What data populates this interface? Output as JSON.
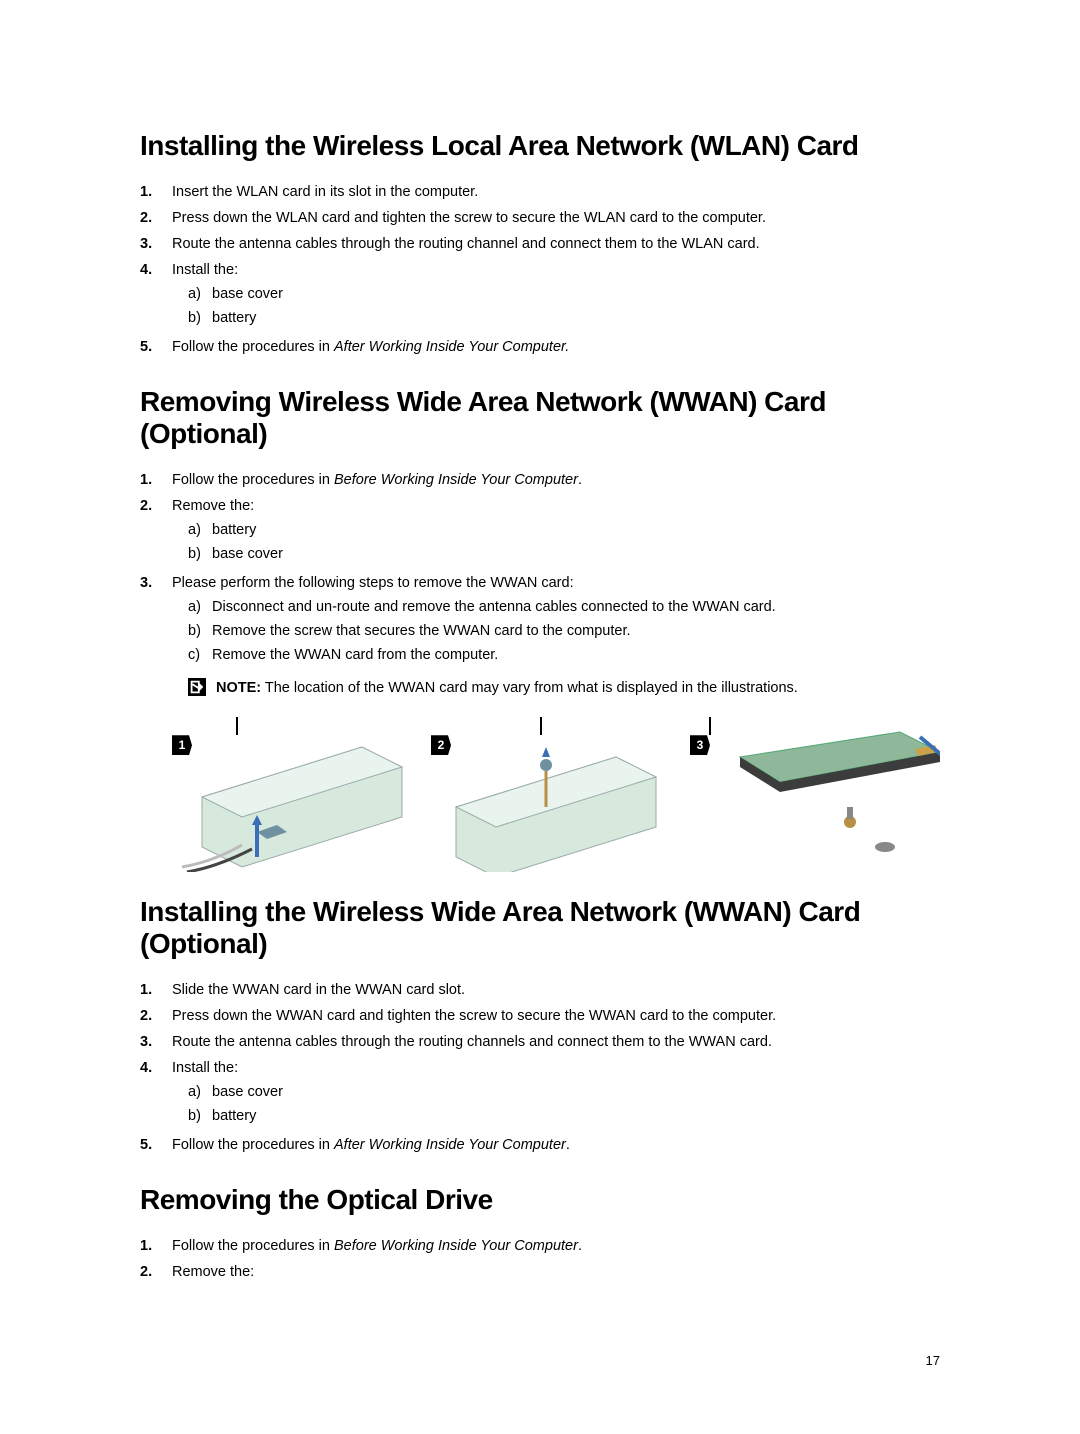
{
  "pageNumber": "17",
  "sections": [
    {
      "heading": "Installing the Wireless Local Area Network (WLAN) Card",
      "steps": [
        {
          "num": "1.",
          "text": "Insert the WLAN card in its slot in the computer."
        },
        {
          "num": "2.",
          "text": "Press down the WLAN card and tighten the screw to secure the WLAN card to the computer."
        },
        {
          "num": "3.",
          "text": "Route the antenna cables through the routing channel and connect them to the WLAN card."
        },
        {
          "num": "4.",
          "text": "Install the:",
          "sub": [
            {
              "mark": "a)",
              "text": "base cover"
            },
            {
              "mark": "b)",
              "text": "battery"
            }
          ]
        },
        {
          "num": "5.",
          "prefix": "Follow the procedures in ",
          "italic": "After Working Inside Your Computer.",
          "suffix": ""
        }
      ]
    },
    {
      "heading": "Removing Wireless Wide Area Network (WWAN) Card (Optional)",
      "steps": [
        {
          "num": "1.",
          "prefix": "Follow the procedures in ",
          "italic": "Before Working Inside Your Computer",
          "suffix": "."
        },
        {
          "num": "2.",
          "text": "Remove the:",
          "sub": [
            {
              "mark": "a)",
              "text": "battery"
            },
            {
              "mark": "b)",
              "text": "base cover"
            }
          ]
        },
        {
          "num": "3.",
          "text": "Please perform the following steps to remove the WWAN card:",
          "sub": [
            {
              "mark": "a)",
              "text": "Disconnect and un-route and remove the antenna cables connected to the WWAN card."
            },
            {
              "mark": "b)",
              "text": "Remove the screw that secures the WWAN card to the computer."
            },
            {
              "mark": "c)",
              "text": "Remove the WWAN card from the computer."
            }
          ],
          "note": {
            "label": "NOTE:",
            "text": " The location of the WWAN card may vary from what is displayed in the illustrations."
          }
        }
      ],
      "figures": [
        {
          "label": "1"
        },
        {
          "label": "2"
        },
        {
          "label": "3"
        }
      ]
    },
    {
      "heading": "Installing the Wireless Wide Area Network (WWAN) Card (Optional)",
      "steps": [
        {
          "num": "1.",
          "text": "Slide the WWAN card in the WWAN card slot."
        },
        {
          "num": "2.",
          "text": "Press down the WWAN card and tighten the screw to secure the WWAN card to the computer."
        },
        {
          "num": "3.",
          "text": "Route the antenna cables through the routing channels and connect them to the WWAN card."
        },
        {
          "num": "4.",
          "text": "Install the:",
          "sub": [
            {
              "mark": "a)",
              "text": "base cover"
            },
            {
              "mark": "b)",
              "text": "battery"
            }
          ]
        },
        {
          "num": "5.",
          "prefix": "Follow the procedures in ",
          "italic": "After Working Inside Your Computer",
          "suffix": "."
        }
      ]
    },
    {
      "heading": "Removing the Optical Drive",
      "steps": [
        {
          "num": "1.",
          "prefix": "Follow the procedures in ",
          "italic": "Before Working Inside Your Computer",
          "suffix": "."
        },
        {
          "num": "2.",
          "text": "Remove the:"
        }
      ]
    }
  ]
}
